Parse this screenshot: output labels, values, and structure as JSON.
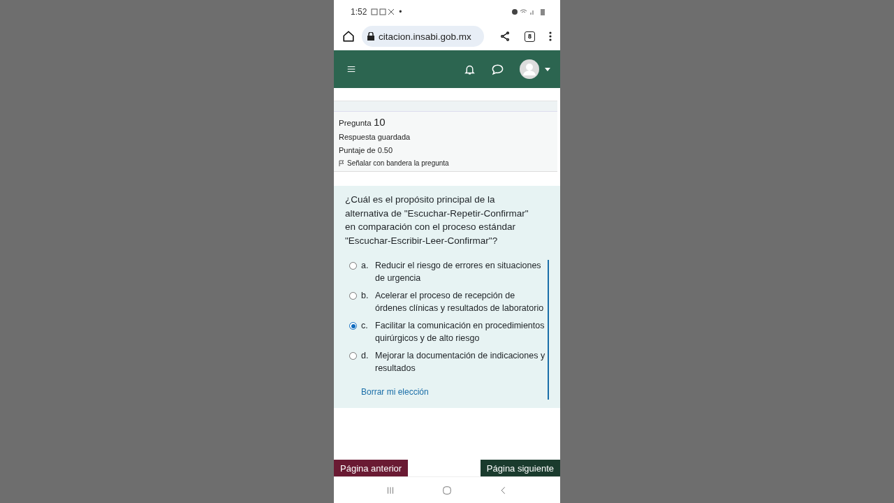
{
  "status_bar": {
    "time": "1:52",
    "dot": "•"
  },
  "browser": {
    "url": "citacion.insabi.gob.mx",
    "tab_count": "8"
  },
  "question_info": {
    "label": "Pregunta",
    "number": "10",
    "state": "Respuesta guardada",
    "grade": "Puntaje de 0.50",
    "flag": "Señalar con bandera la pregunta"
  },
  "question": {
    "text": "¿Cuál es el propósito principal de la alternativa de \"Escuchar-Repetir-Confirmar\" en comparación con el proceso estándar \"Escuchar-Escribir-Leer-Confirmar\"?",
    "options": [
      {
        "letter": "a.",
        "text": "Reducir el riesgo de errores en situaciones de urgencia",
        "selected": false
      },
      {
        "letter": "b.",
        "text": "Acelerar el proceso de recepción de órdenes clínicas y resultados de laboratorio",
        "selected": false
      },
      {
        "letter": "c.",
        "text": "Facilitar la comunicación en procedimientos quirúrgicos y de alto riesgo",
        "selected": true
      },
      {
        "letter": "d.",
        "text": "Mejorar la documentación de indicaciones y resultados",
        "selected": false
      }
    ],
    "clear_link": "Borrar mi elección"
  },
  "navigation": {
    "previous": "Página anterior",
    "next": "Página siguiente"
  }
}
